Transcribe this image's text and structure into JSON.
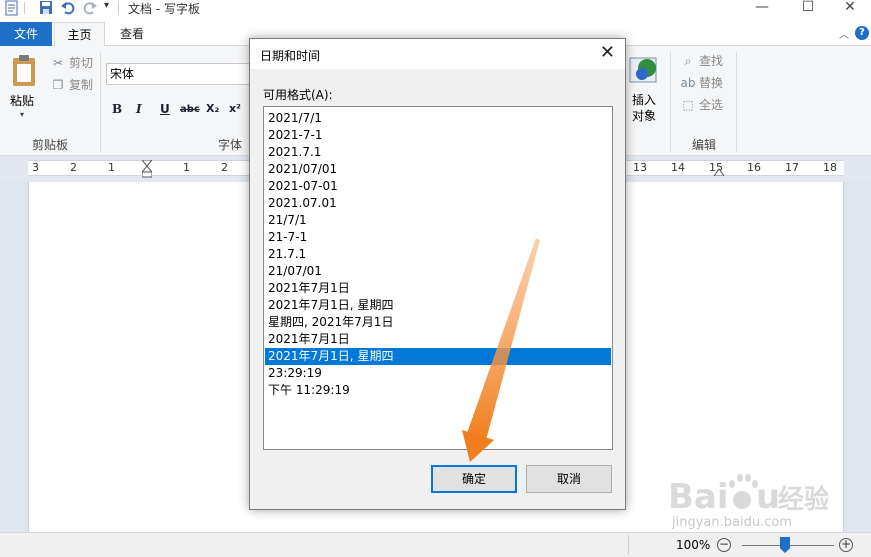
{
  "window": {
    "title": "文档 - 写字板"
  },
  "tabs": [
    {
      "label": "文件"
    },
    {
      "label": "主页"
    },
    {
      "label": "查看"
    }
  ],
  "ribbon": {
    "clipboard": {
      "paste_label": "粘贴",
      "cut_label": "剪切",
      "copy_label": "复制",
      "group_label": "剪贴板"
    },
    "font": {
      "font_name": "宋体",
      "group_label": "字体",
      "buttons": [
        "B",
        "I",
        "U",
        "abc",
        "X₂",
        "x²"
      ]
    },
    "insert": {
      "insert_object_label_line1": "插入",
      "insert_object_label_line2": "对象"
    },
    "editing": {
      "find_label": "查找",
      "replace_label": "替换",
      "select_all_label": "全选",
      "group_label": "编辑"
    }
  },
  "ruler": {
    "left_numbers": [
      "3",
      "2",
      "1",
      "1",
      "2"
    ],
    "right_numbers": [
      "13",
      "14",
      "15",
      "16",
      "17",
      "18"
    ]
  },
  "dialog": {
    "title": "日期和时间",
    "formats_label": "可用格式(A):",
    "formats": [
      "2021/7/1",
      "2021-7-1",
      "2021.7.1",
      "2021/07/01",
      "2021-07-01",
      "2021.07.01",
      "21/7/1",
      "21-7-1",
      "21.7.1",
      "21/07/01",
      "2021年7月1日",
      "2021年7月1日, 星期四",
      "星期四, 2021年7月1日",
      "2021年7月1日",
      "2021年7月1日, 星期四",
      "23:29:19",
      "下午 11:29:19"
    ],
    "selected_index": 14,
    "ok_label": "确定",
    "cancel_label": "取消"
  },
  "statusbar": {
    "zoom": "100%"
  },
  "watermark": {
    "brand": "Baidu经验",
    "url": "jingyan.baidu.com"
  },
  "colors": {
    "accent": "#0078d7",
    "file_tab": "#1e6fc7",
    "arrow": "#f08a34"
  }
}
